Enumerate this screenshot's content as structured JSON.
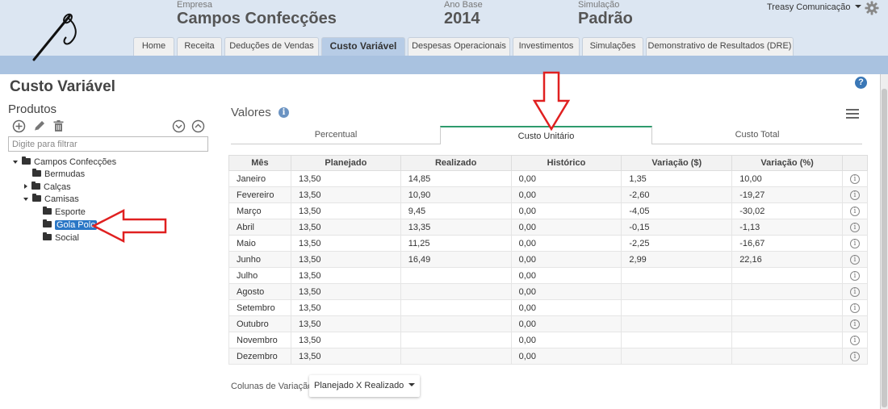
{
  "header": {
    "empresa_label": "Empresa",
    "empresa_value": "Campos Confecções",
    "ano_label": "Ano Base",
    "ano_value": "2014",
    "sim_label": "Simulação",
    "sim_value": "Padrão",
    "user": "Treasy Comunicação"
  },
  "tabs": [
    "Home",
    "Receita",
    "Deduções de Vendas",
    "Custo Variável",
    "Despesas Operacionais",
    "Investimentos",
    "Simulações",
    "Demonstrativo de Resultados (DRE)"
  ],
  "active_tab": "Custo Variável",
  "page_title": "Custo Variável",
  "help_glyph": "?",
  "produtos": {
    "title": "Produtos",
    "filter_placeholder": "Digite para filtrar",
    "tree": [
      "Campos Confecções",
      "Bermudas",
      "Calças",
      "Camisas",
      "Esporte",
      "Gola Polo",
      "Social"
    ],
    "selected": "Gola Polo"
  },
  "valores": {
    "title": "Valores",
    "info_glyph": "i",
    "subtabs": [
      "Percentual",
      "Custo Unitário",
      "Custo Total"
    ],
    "active_subtab": "Custo Unitário"
  },
  "table": {
    "headers": [
      "Mês",
      "Planejado",
      "Realizado",
      "Histórico",
      "Variação ($)",
      "Variação (%)",
      ""
    ],
    "rows": [
      [
        "Janeiro",
        "13,50",
        "14,85",
        "0,00",
        "1,35",
        "10,00"
      ],
      [
        "Fevereiro",
        "13,50",
        "10,90",
        "0,00",
        "-2,60",
        "-19,27"
      ],
      [
        "Março",
        "13,50",
        "9,45",
        "0,00",
        "-4,05",
        "-30,02"
      ],
      [
        "Abril",
        "13,50",
        "13,35",
        "0,00",
        "-0,15",
        "-1,13"
      ],
      [
        "Maio",
        "13,50",
        "11,25",
        "0,00",
        "-2,25",
        "-16,67"
      ],
      [
        "Junho",
        "13,50",
        "16,49",
        "0,00",
        "2,99",
        "22,16"
      ],
      [
        "Julho",
        "13,50",
        "",
        "0,00",
        "",
        ""
      ],
      [
        "Agosto",
        "13,50",
        "",
        "0,00",
        "",
        ""
      ],
      [
        "Setembro",
        "13,50",
        "",
        "0,00",
        "",
        ""
      ],
      [
        "Outubro",
        "13,50",
        "",
        "0,00",
        "",
        ""
      ],
      [
        "Novembro",
        "13,50",
        "",
        "0,00",
        "",
        ""
      ],
      [
        "Dezembro",
        "13,50",
        "",
        "0,00",
        "",
        ""
      ]
    ],
    "row_info_glyph": "i"
  },
  "footer": {
    "label": "Colunas de Variação:",
    "dropdown_value": "Planejado X Realizado"
  },
  "colors": {
    "header_bg": "#dce6f2",
    "band": "#a9c2e0",
    "active_tab": "#b7cce6",
    "negative": "#2a7d1a",
    "positive": "#d52b2b",
    "annotation_arrow": "#e02020",
    "subtab_accent": "#2e9b6d"
  }
}
